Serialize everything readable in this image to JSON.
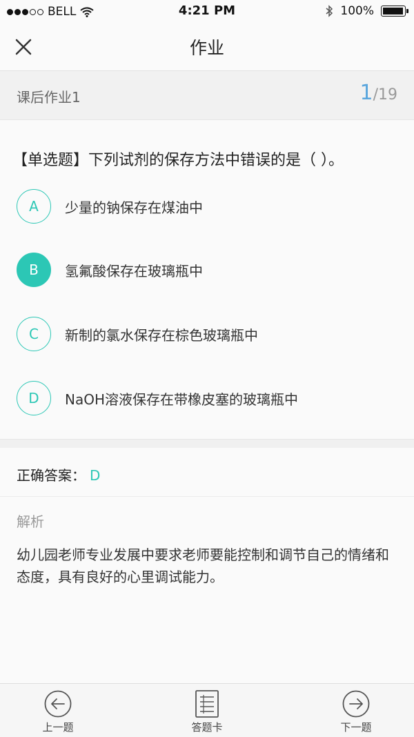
{
  "status_bar": {
    "carrier": "BELL",
    "time": "4:21 PM",
    "battery": "100%",
    "battery_level": 1.0,
    "signal_bars": 3,
    "signal_total": 5
  },
  "nav": {
    "title": "作业",
    "close_icon": "close-icon"
  },
  "progress": {
    "assignment_name": "课后作业1",
    "current": "1",
    "total": "/19"
  },
  "question": {
    "text": "【单选题】下列试剂的保存方法中错误的是（ ）。",
    "options": [
      {
        "letter": "A",
        "text": "少量的钠保存在煤油中",
        "selected": false
      },
      {
        "letter": "B",
        "text": "氢氟酸保存在玻璃瓶中",
        "selected": true
      },
      {
        "letter": "C",
        "text": "新制的氯水保存在棕色玻璃瓶中",
        "selected": false
      },
      {
        "letter": "D",
        "text": "NaOH溶液保存在带橡皮塞的玻璃瓶中",
        "selected": false
      }
    ]
  },
  "answer": {
    "label": "正确答案：",
    "value": "D"
  },
  "analysis": {
    "title": "解析",
    "text": "幼儿园老师专业发展中要求老师要能控制和调节自己的情绪和态度，具有良好的心里调试能力。"
  },
  "bottom_bar": {
    "prev_label": "上一题",
    "card_label": "答题卡",
    "next_label": "下一题"
  },
  "colors": {
    "accent": "#2cc7b5",
    "counter_blue": "#5aa6dd"
  }
}
